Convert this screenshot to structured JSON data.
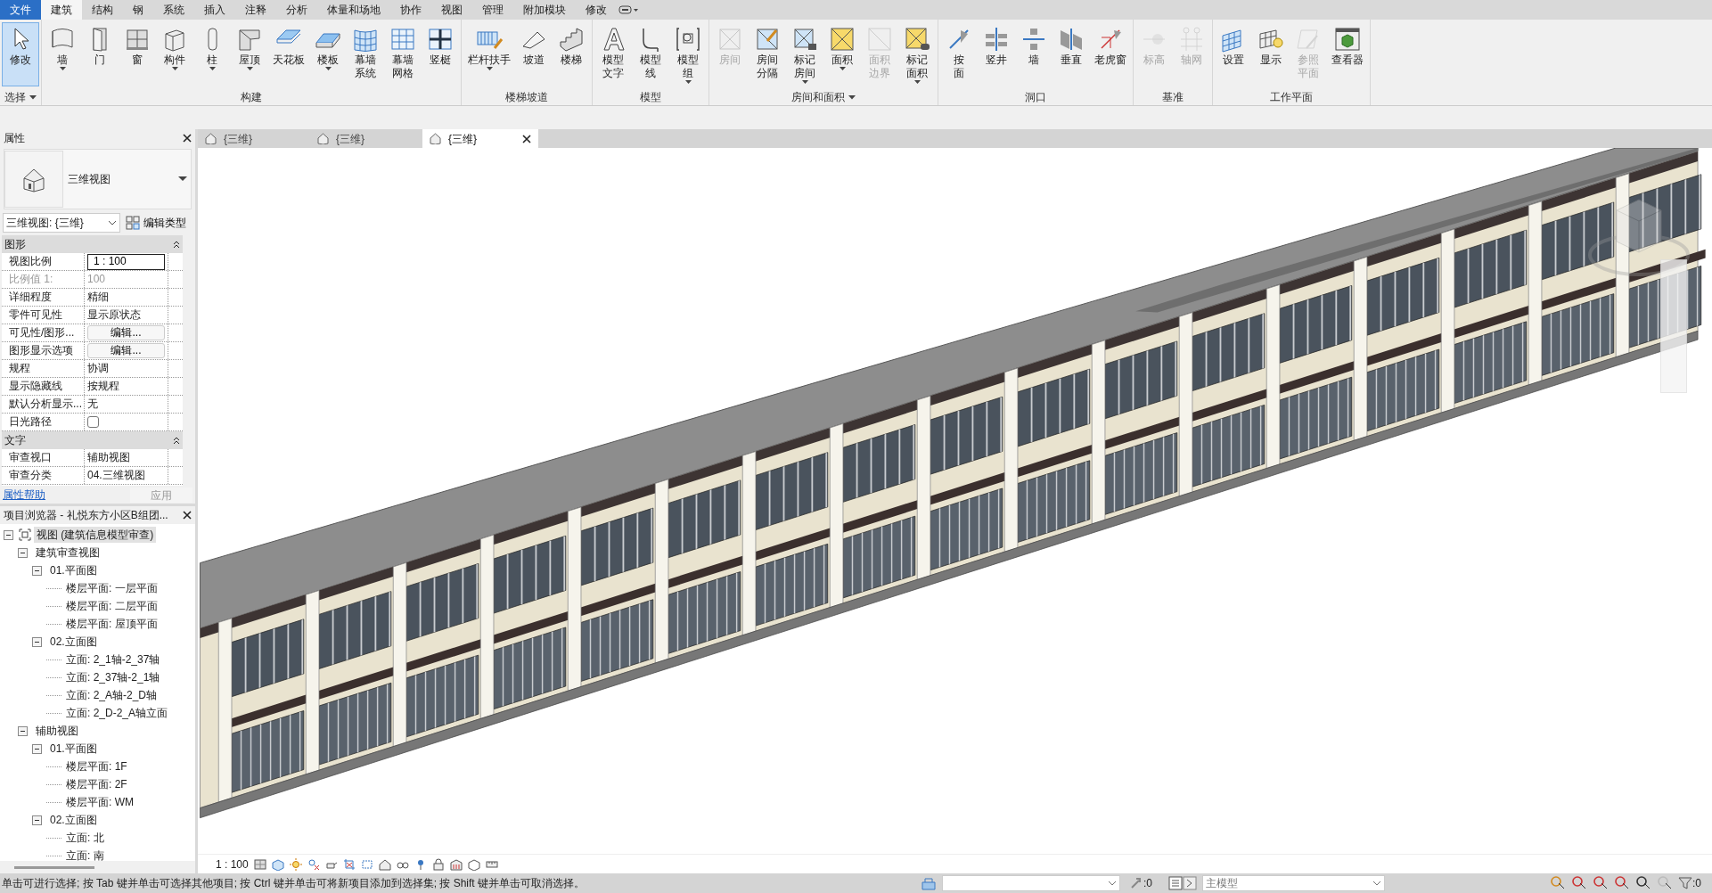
{
  "menu_tabs": [
    {
      "label": "文件",
      "kind": "file",
      "selected": false
    },
    {
      "label": "建筑",
      "kind": "tab",
      "selected": true
    },
    {
      "label": "结构",
      "kind": "tab",
      "selected": false
    },
    {
      "label": "钢",
      "kind": "tab",
      "selected": false
    },
    {
      "label": "系统",
      "kind": "tab",
      "selected": false
    },
    {
      "label": "插入",
      "kind": "tab",
      "selected": false
    },
    {
      "label": "注释",
      "kind": "tab",
      "selected": false
    },
    {
      "label": "分析",
      "kind": "tab",
      "selected": false
    },
    {
      "label": "体量和场地",
      "kind": "tab",
      "selected": false
    },
    {
      "label": "协作",
      "kind": "tab",
      "selected": false
    },
    {
      "label": "视图",
      "kind": "tab",
      "selected": false
    },
    {
      "label": "管理",
      "kind": "tab",
      "selected": false
    },
    {
      "label": "附加模块",
      "kind": "tab",
      "selected": false
    },
    {
      "label": "修改",
      "kind": "tab",
      "selected": false
    }
  ],
  "ribbon": [
    {
      "label": "选择",
      "dropdown": true,
      "tools": [
        {
          "label": "修改",
          "selected": true,
          "disabled": false,
          "dropdown": false
        }
      ]
    },
    {
      "label": "构建",
      "dropdown": false,
      "tools": [
        {
          "label": "墙",
          "selected": false,
          "disabled": false,
          "dropdown": true
        },
        {
          "label": "门",
          "selected": false,
          "disabled": false,
          "dropdown": false
        },
        {
          "label": "窗",
          "selected": false,
          "disabled": false,
          "dropdown": false
        },
        {
          "label": "构件",
          "selected": false,
          "disabled": false,
          "dropdown": true
        },
        {
          "label": "柱",
          "selected": false,
          "disabled": false,
          "dropdown": true
        },
        {
          "label": "屋顶",
          "selected": false,
          "disabled": false,
          "dropdown": true
        },
        {
          "label": "天花板",
          "selected": false,
          "disabled": false,
          "dropdown": false
        },
        {
          "label": "楼板",
          "selected": false,
          "disabled": false,
          "dropdown": true
        },
        {
          "label": "幕墙系统",
          "wrap": true,
          "selected": false,
          "disabled": false,
          "dropdown": false
        },
        {
          "label": "幕墙网格",
          "wrap": true,
          "selected": false,
          "disabled": false,
          "dropdown": false
        },
        {
          "label": "竖梃",
          "selected": false,
          "disabled": false,
          "dropdown": false
        }
      ]
    },
    {
      "label": "楼梯坡道",
      "dropdown": false,
      "tools": [
        {
          "label": "栏杆扶手",
          "selected": false,
          "disabled": false,
          "dropdown": true
        },
        {
          "label": "坡道",
          "selected": false,
          "disabled": false,
          "dropdown": false
        },
        {
          "label": "楼梯",
          "selected": false,
          "disabled": false,
          "dropdown": false
        }
      ]
    },
    {
      "label": "模型",
      "dropdown": false,
      "tools": [
        {
          "label": "模型文字",
          "wrap": true,
          "selected": false,
          "disabled": false,
          "dropdown": false
        },
        {
          "label": "模型线",
          "wrap": true,
          "selected": false,
          "disabled": false,
          "dropdown": false
        },
        {
          "label": "模型组",
          "wrap": true,
          "selected": false,
          "disabled": false,
          "dropdown": true
        }
      ]
    },
    {
      "label": "房间和面积",
      "dropdown": true,
      "tools": [
        {
          "label": "房间",
          "selected": false,
          "disabled": true,
          "dropdown": false
        },
        {
          "label": "房间分隔",
          "wrap": true,
          "selected": false,
          "disabled": false,
          "dropdown": false
        },
        {
          "label": "标记房间",
          "wrap": true,
          "selected": false,
          "disabled": false,
          "dropdown": true
        },
        {
          "label": "面积",
          "selected": false,
          "disabled": false,
          "dropdown": true
        },
        {
          "label": "面积边界",
          "wrap": true,
          "selected": false,
          "disabled": true,
          "dropdown": false
        },
        {
          "label": "标记面积",
          "wrap": true,
          "selected": false,
          "disabled": false,
          "dropdown": true
        }
      ]
    },
    {
      "label": "洞口",
      "dropdown": false,
      "tools": [
        {
          "label": "按面",
          "wrap": true,
          "selected": false,
          "disabled": false,
          "dropdown": false
        },
        {
          "label": "竖井",
          "selected": false,
          "disabled": false,
          "dropdown": false
        },
        {
          "label": "墙",
          "selected": false,
          "disabled": false,
          "dropdown": false
        },
        {
          "label": "垂直",
          "selected": false,
          "disabled": false,
          "dropdown": false
        },
        {
          "label": "老虎窗",
          "selected": false,
          "disabled": false,
          "dropdown": false
        }
      ]
    },
    {
      "label": "基准",
      "dropdown": false,
      "tools": [
        {
          "label": "标高",
          "selected": false,
          "disabled": true,
          "dropdown": false
        },
        {
          "label": "轴网",
          "selected": false,
          "disabled": true,
          "dropdown": false
        }
      ]
    },
    {
      "label": "工作平面",
      "dropdown": false,
      "tools": [
        {
          "label": "设置",
          "selected": false,
          "disabled": false,
          "dropdown": false
        },
        {
          "label": "显示",
          "selected": false,
          "disabled": false,
          "dropdown": false
        },
        {
          "label": "参照平面",
          "wrap": true,
          "selected": false,
          "disabled": true,
          "dropdown": false
        },
        {
          "label": "查看器",
          "selected": false,
          "disabled": false,
          "dropdown": false
        }
      ]
    }
  ],
  "properties": {
    "title": "属性",
    "type_name": "三维视图",
    "type_selector": "三维视图: {三维}",
    "edit_type_button": "编辑类型",
    "sections": [
      {
        "label": "图形",
        "expanded": true,
        "rows": [
          {
            "name": "视图比例",
            "value": "1 : 100",
            "kind": "input",
            "disabled": false
          },
          {
            "name": "比例值 1:",
            "value": "100",
            "kind": "text",
            "disabled": true
          },
          {
            "name": "详细程度",
            "value": "精细",
            "kind": "text",
            "disabled": false
          },
          {
            "name": "零件可见性",
            "value": "显示原状态",
            "kind": "text",
            "disabled": false
          },
          {
            "name": "可见性/图形...",
            "value": "编辑...",
            "kind": "button",
            "disabled": false
          },
          {
            "name": "图形显示选项",
            "value": "编辑...",
            "kind": "button",
            "disabled": false
          },
          {
            "name": "规程",
            "value": "协调",
            "kind": "text",
            "disabled": false
          },
          {
            "name": "显示隐藏线",
            "value": "按规程",
            "kind": "text",
            "disabled": false
          },
          {
            "name": "默认分析显示...",
            "value": "无",
            "kind": "text",
            "disabled": false
          },
          {
            "name": "日光路径",
            "kind": "checkbox",
            "checked": false,
            "disabled": false
          }
        ]
      },
      {
        "label": "文字",
        "expanded": true,
        "rows": [
          {
            "name": "审查视口",
            "value": "辅助视图",
            "kind": "text",
            "disabled": false
          },
          {
            "name": "审查分类",
            "value": "04.三维视图",
            "kind": "text",
            "disabled": false
          }
        ]
      }
    ],
    "help_link": "属性帮助",
    "apply_button": "应用"
  },
  "project_browser": {
    "title": "项目浏览器 - 礼悦东方小区B组团...",
    "tree": [
      {
        "label": "视图 (建筑信息模型审查)",
        "selected": true,
        "expanded": true,
        "children": [
          {
            "label": "建筑审查视图",
            "selected": false,
            "expanded": true,
            "children": [
              {
                "label": "01.平面图",
                "selected": false,
                "expanded": true,
                "children": [
                  {
                    "label": "楼层平面: 一层平面",
                    "selected": false
                  },
                  {
                    "label": "楼层平面: 二层平面",
                    "selected": false
                  },
                  {
                    "label": "楼层平面: 屋顶平面",
                    "selected": false
                  }
                ]
              },
              {
                "label": "02.立面图",
                "selected": false,
                "expanded": true,
                "children": [
                  {
                    "label": "立面: 2_1轴-2_37轴",
                    "selected": false
                  },
                  {
                    "label": "立面: 2_37轴-2_1轴",
                    "selected": false
                  },
                  {
                    "label": "立面: 2_A轴-2_D轴",
                    "selected": false
                  },
                  {
                    "label": "立面: 2_D-2_A轴立面",
                    "selected": false
                  }
                ]
              }
            ]
          },
          {
            "label": "辅助视图",
            "selected": false,
            "expanded": true,
            "children": [
              {
                "label": "01.平面图",
                "selected": false,
                "expanded": true,
                "children": [
                  {
                    "label": "楼层平面: 1F",
                    "selected": false
                  },
                  {
                    "label": "楼层平面: 2F",
                    "selected": false
                  },
                  {
                    "label": "楼层平面: WM",
                    "selected": false
                  }
                ]
              },
              {
                "label": "02.立面图",
                "selected": false,
                "expanded": true,
                "children": [
                  {
                    "label": "立面: 北",
                    "selected": false
                  },
                  {
                    "label": "立面: 南",
                    "selected": false
                  }
                ]
              }
            ]
          }
        ]
      }
    ]
  },
  "view_tabs": [
    {
      "label": "{三维}",
      "selected": false
    },
    {
      "label": "{三维}",
      "selected": false
    },
    {
      "label": "{三维}",
      "selected": true
    }
  ],
  "view_control": {
    "scale": "1 : 100"
  },
  "status_bar": {
    "message": "单击可进行选择; 按 Tab 键并单击可选择其他项目; 按 Ctrl 键并单击可将新项目添加到选择集; 按 Shift 键并单击可取消选择。",
    "editable_count": ":0",
    "design_option": "主模型",
    "filter_count": ":0"
  }
}
